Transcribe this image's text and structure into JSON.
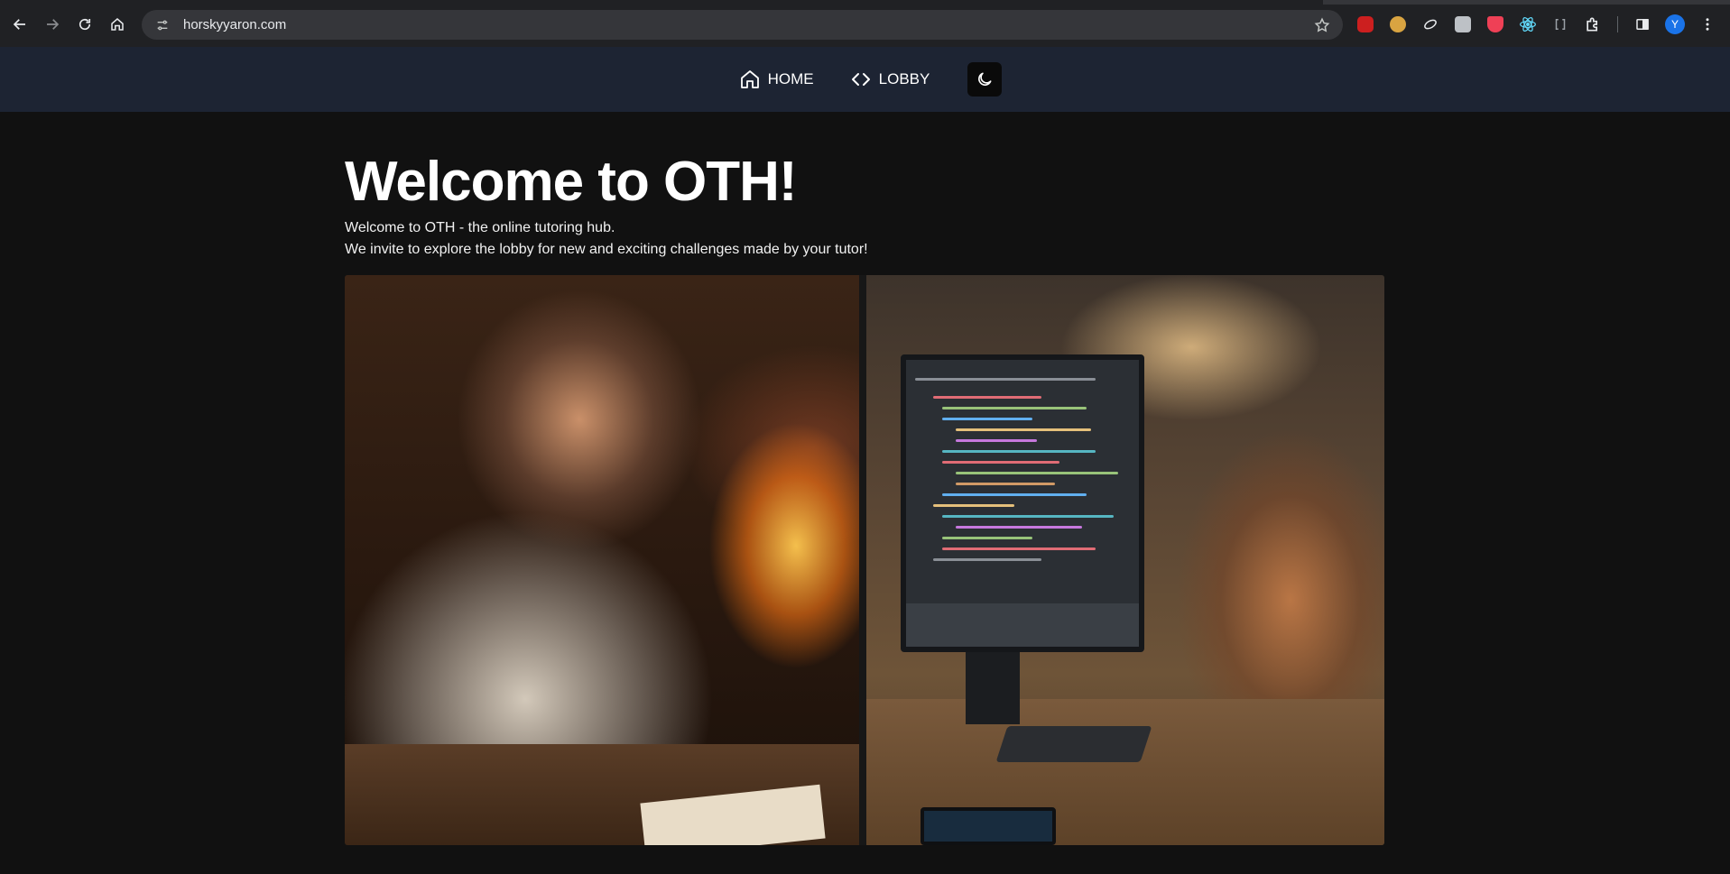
{
  "browser": {
    "url": "horskyyaron.com",
    "avatar_letter": "Y",
    "extensions": [
      "youtube-ext-icon",
      "face-ext-icon",
      "comet-ext-icon",
      "image-ext-icon",
      "pocket-icon",
      "react-devtools-icon",
      "css-ext-icon",
      "puzzle-icon"
    ],
    "colors": {
      "chrome_bg": "#202124",
      "omnibox_bg": "#35363a",
      "avatar_bg": "#1a73e8"
    }
  },
  "nav": {
    "home_label": "HOME",
    "lobby_label": "LOBBY",
    "colors": {
      "bg": "#1d2433",
      "toggle_bg": "#0a0a0a"
    }
  },
  "main": {
    "title": "Welcome to OTH!",
    "intro_line_1": "Welcome to OTH - the online tutoring hub.",
    "intro_line_2": "We invite to explore the lobby for new and exciting challenges made by your tutor!",
    "colors": {
      "page_bg": "#111111"
    }
  }
}
